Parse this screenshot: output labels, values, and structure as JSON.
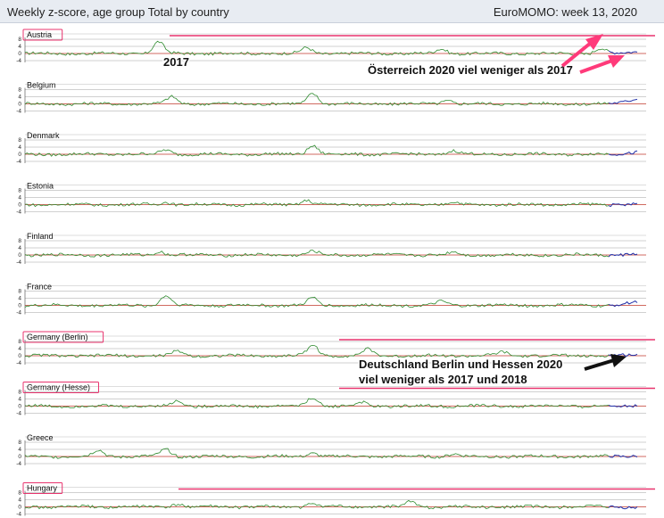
{
  "header": {
    "title": "Weekly z-score, age group Total by country",
    "week": "EuroMOMO: week 13, 2020"
  },
  "colors": {
    "series_past": "#2e8b2e",
    "series_recent": "#1f2fa8",
    "baseline": "#c0392b",
    "highlight": "#e8336e",
    "arrow": "#ff3a7a",
    "gridline": "#888888"
  },
  "chart_data": {
    "type": "line",
    "y_ticks": [
      "8",
      "4",
      "0",
      "-4"
    ],
    "ylim": [
      -4,
      8
    ],
    "panels": [
      {
        "country": "Austria",
        "highlighted": true,
        "peaks": [
          [
            0.218,
            6.5
          ],
          [
            0.46,
            3.2
          ],
          [
            0.68,
            2.5
          ],
          [
            0.94,
            3.0
          ]
        ],
        "end_spike": 1.0
      },
      {
        "country": "Belgium",
        "highlighted": false,
        "peaks": [
          [
            0.24,
            4.0
          ],
          [
            0.47,
            6.0
          ],
          [
            0.69,
            2.0
          ]
        ],
        "end_spike": 3.5
      },
      {
        "country": "Denmark",
        "highlighted": false,
        "peaks": [
          [
            0.23,
            2.5
          ],
          [
            0.47,
            5.0
          ],
          [
            0.7,
            2.0
          ]
        ],
        "end_spike": 1.5
      },
      {
        "country": "Estonia",
        "highlighted": false,
        "peaks": [
          [
            0.46,
            2.5
          ],
          [
            0.23,
            1.5
          ],
          [
            0.7,
            1.2
          ]
        ],
        "end_spike": 0.5
      },
      {
        "country": "Finland",
        "highlighted": false,
        "peaks": [
          [
            0.22,
            2.0
          ],
          [
            0.47,
            2.0
          ],
          [
            0.7,
            1.5
          ]
        ],
        "end_spike": 0.5
      },
      {
        "country": "France",
        "highlighted": false,
        "peaks": [
          [
            0.23,
            5.5
          ],
          [
            0.47,
            4.0
          ],
          [
            0.68,
            2.0
          ]
        ],
        "end_spike": 2.0
      },
      {
        "country": "Germany (Berlin)",
        "highlighted": true,
        "peaks": [
          [
            0.25,
            2.5
          ],
          [
            0.47,
            6.0
          ],
          [
            0.56,
            3.5
          ],
          [
            0.78,
            2.0
          ]
        ],
        "end_spike": 0.5
      },
      {
        "country": "Germany (Hesse)",
        "highlighted": true,
        "peaks": [
          [
            0.25,
            3.0
          ],
          [
            0.47,
            5.0
          ],
          [
            0.55,
            2.0
          ]
        ],
        "end_spike": 0.3
      },
      {
        "country": "Greece",
        "highlighted": false,
        "peaks": [
          [
            0.12,
            3.5
          ],
          [
            0.23,
            4.0
          ],
          [
            0.47,
            2.0
          ],
          [
            0.7,
            1.5
          ]
        ],
        "end_spike": 0.5
      },
      {
        "country": "Hungary",
        "highlighted": true,
        "peaks": [
          [
            0.25,
            1.5
          ],
          [
            0.47,
            2.0
          ],
          [
            0.63,
            3.0
          ]
        ],
        "end_spike": -0.5
      }
    ]
  },
  "annotations": {
    "label_2017": "2017",
    "austria_note": "Österreich 2020 viel weniger als 2017",
    "germany_note_line1": "Deutschland Berlin und Hessen 2020",
    "germany_note_line2": "viel weniger als 2017 und 2018"
  }
}
